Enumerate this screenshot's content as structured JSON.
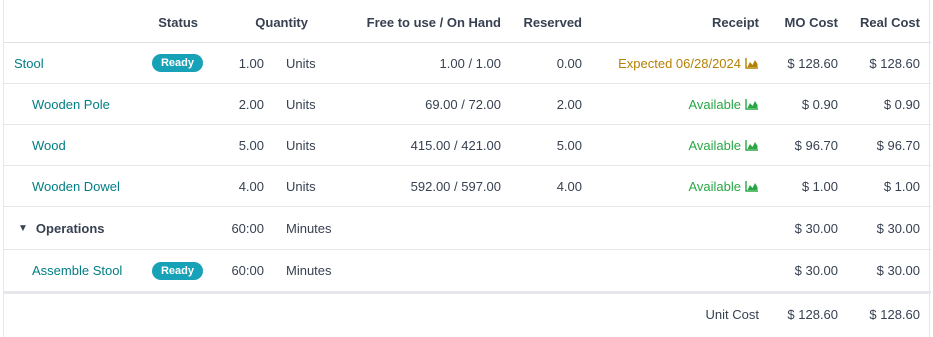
{
  "columns": {
    "status": "Status",
    "quantity": "Quantity",
    "free_on_hand": "Free to use / On Hand",
    "reserved": "Reserved",
    "receipt": "Receipt",
    "mo_cost": "MO Cost",
    "real_cost": "Real Cost"
  },
  "rows": [
    {
      "product": "Stool",
      "status": "Ready",
      "qty": "1.00",
      "uom": "Units",
      "free_on_hand": "1.00 / 1.00",
      "reserved": "0.00",
      "receipt": "Expected 06/28/2024",
      "mo_cost": "$ 128.60",
      "real_cost": "$ 128.60"
    },
    {
      "product": "Wooden Pole",
      "qty": "2.00",
      "uom": "Units",
      "free_on_hand": "69.00 / 72.00",
      "reserved": "2.00",
      "receipt": "Available",
      "mo_cost": "$ 0.90",
      "real_cost": "$ 0.90"
    },
    {
      "product": "Wood",
      "qty": "5.00",
      "uom": "Units",
      "free_on_hand": "415.00 / 421.00",
      "reserved": "5.00",
      "receipt": "Available",
      "mo_cost": "$ 96.70",
      "real_cost": "$ 96.70"
    },
    {
      "product": "Wooden Dowel",
      "qty": "4.00",
      "uom": "Units",
      "free_on_hand": "592.00 / 597.00",
      "reserved": "4.00",
      "receipt": "Available",
      "mo_cost": "$ 1.00",
      "real_cost": "$ 1.00"
    }
  ],
  "operations": {
    "title": "Operations",
    "qty": "60:00",
    "uom": "Minutes",
    "mo_cost": "$ 30.00",
    "real_cost": "$ 30.00",
    "items": [
      {
        "name": "Assemble Stool",
        "status": "Ready",
        "qty": "60:00",
        "uom": "Minutes",
        "mo_cost": "$ 30.00",
        "real_cost": "$ 30.00"
      }
    ]
  },
  "footer": {
    "label": "Unit Cost",
    "mo_cost": "$ 128.60",
    "real_cost": "$ 128.60"
  },
  "colors": {
    "link": "#017e84",
    "badge": "#17a2b8",
    "expected": "#b58105",
    "available": "#28a745"
  },
  "icons": {
    "forecast": "area-chart-icon",
    "collapse": "caret-down-icon"
  }
}
